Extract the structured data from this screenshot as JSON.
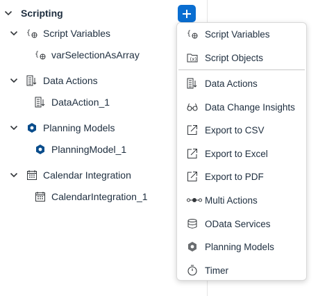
{
  "panel": {
    "title": "Scripting",
    "nodes": [
      {
        "label": "Script Variables",
        "icon": "script-variable-icon",
        "children": [
          {
            "label": "varSelectionAsArray",
            "icon": "script-variable-icon"
          }
        ]
      },
      {
        "label": "Data Actions",
        "icon": "data-action-icon",
        "children": [
          {
            "label": "DataAction_1",
            "icon": "data-action-icon"
          }
        ]
      },
      {
        "label": "Planning Models",
        "icon": "planning-model-icon",
        "children": [
          {
            "label": "PlanningModel_1",
            "icon": "planning-model-icon"
          }
        ]
      },
      {
        "label": "Calendar Integration",
        "icon": "calendar-icon",
        "children": [
          {
            "label": "CalendarIntegration_1",
            "icon": "calendar-icon"
          }
        ]
      }
    ]
  },
  "add_button": {
    "icon": "plus-icon"
  },
  "menu": {
    "items": [
      {
        "label": "Script Variables",
        "icon": "script-variable-icon"
      },
      {
        "label": "Script Objects",
        "icon": "script-object-icon"
      },
      {
        "label": "Data Actions",
        "icon": "data-action-icon"
      },
      {
        "label": "Data Change Insights",
        "icon": "glasses-icon"
      },
      {
        "label": "Export to CSV",
        "icon": "export-icon"
      },
      {
        "label": "Export to Excel",
        "icon": "export-icon"
      },
      {
        "label": "Export to PDF",
        "icon": "export-icon"
      },
      {
        "label": "Multi Actions",
        "icon": "multi-action-icon"
      },
      {
        "label": "OData Services",
        "icon": "database-icon"
      },
      {
        "label": "Planning Models",
        "icon": "planning-model-icon"
      },
      {
        "label": "Timer",
        "icon": "timer-icon"
      }
    ]
  },
  "colors": {
    "accent": "#0a6ed1",
    "text": "#1d2d3e",
    "icon": "#32363a"
  }
}
